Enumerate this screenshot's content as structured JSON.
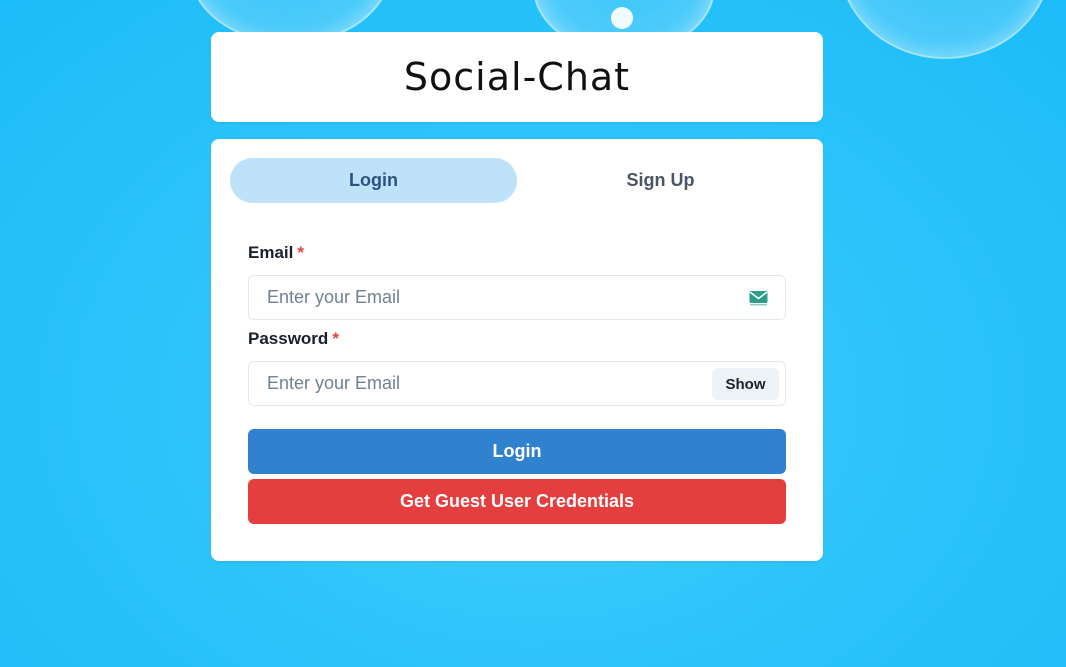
{
  "app": {
    "title": "Social-Chat"
  },
  "tabs": [
    {
      "label": "Login",
      "active": true
    },
    {
      "label": "Sign Up",
      "active": false
    }
  ],
  "form": {
    "email": {
      "label": "Email",
      "required_mark": "*",
      "value": "",
      "placeholder": "Enter your Email",
      "icon": "mail-icon"
    },
    "password": {
      "label": "Password",
      "required_mark": "*",
      "value": "",
      "placeholder": "Enter your Email",
      "toggle_label": "Show"
    },
    "login_button": "Login",
    "guest_button": "Get Guest User Credentials"
  },
  "colors": {
    "background": "#2ec4fb",
    "active_tab": "#bee3f8",
    "login_button": "#3182ce",
    "guest_button": "#e53e3e",
    "required": "#e53e3e"
  }
}
